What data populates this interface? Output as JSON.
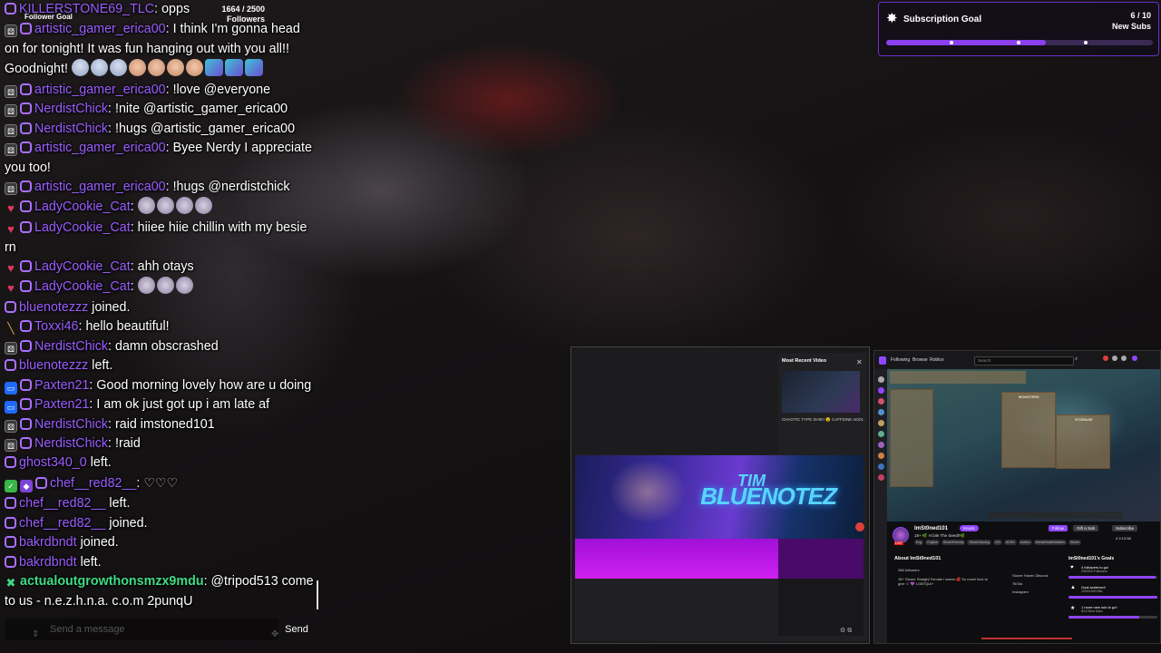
{
  "follower_goal": {
    "title": "Follower Goal",
    "count": "1664 / 2500",
    "unit": "Followers",
    "progress": 0.666
  },
  "chat": {
    "messages": [
      {
        "user": "KILLERSTONE69_TLC",
        "text": "opps"
      },
      {
        "user": "artistic_gamer_erica00",
        "text": "I think I'm gonna head on for tonight! It was fun hanging out with you all!! Goodnight!"
      },
      {
        "user": "artistic_gamer_erica00",
        "text": "!love @everyone"
      },
      {
        "user": "NerdistChick",
        "text": "!nite @artistic_gamer_erica00"
      },
      {
        "user": "NerdistChick",
        "text": "!hugs @artistic_gamer_erica00"
      },
      {
        "user": "artistic_gamer_erica00",
        "text": "Byee Nerdy I appreciate you too!"
      },
      {
        "user": "artistic_gamer_erica00",
        "text": "!hugs @nerdistchick"
      },
      {
        "user": "LadyCookie_Cat",
        "text": ""
      },
      {
        "user": "LadyCookie_Cat",
        "text": "hiiee hiie chillin with my besie rn"
      },
      {
        "user": "LadyCookie_Cat",
        "text": "ahh otays"
      },
      {
        "user": "LadyCookie_Cat",
        "text": ""
      },
      {
        "user": "bluenotezzz",
        "text": "joined."
      },
      {
        "user": "Toxxi46",
        "text": "hello beautiful!"
      },
      {
        "user": "NerdistChick",
        "text": "damn obscrashed"
      },
      {
        "user": "bluenotezzz",
        "text": "left."
      },
      {
        "user": "Paxten21",
        "text": "Good morning lovely how are u doing"
      },
      {
        "user": "Paxten21",
        "text": "I am ok just got up i am late af"
      },
      {
        "user": "NerdistChick",
        "text": "raid imstoned101"
      },
      {
        "user": "NerdistChick",
        "text": "!raid"
      },
      {
        "user": "ghost340_0",
        "text": "left."
      },
      {
        "user": "chef__red82__",
        "text": ""
      },
      {
        "user": "chef__red82__",
        "text": "left."
      },
      {
        "user": "chef__red82__",
        "text": "joined."
      },
      {
        "user": "bakrdbndt",
        "text": "joined."
      },
      {
        "user": "bakrdbndt",
        "text": "left."
      },
      {
        "user": "actualoutgrowthonsmzx9mdu",
        "text": "@tripod513 come to us - n.e.z.h.n.a. c.o.m 2punqU"
      }
    ],
    "input_placeholder": "Send a message",
    "send_label": "Send"
  },
  "subscription_goal": {
    "title": "Subscription Goal",
    "count": "6 / 10",
    "unit": "New Subs",
    "progress": 0.6
  },
  "video_window": {
    "recent_label": "Most Recent Video",
    "video_title": "CHAOTIC TYPE SHIII!! 😵 CAFFEINE ADDI...",
    "banner_text": "BLUENOTEZ",
    "banner_small": "TIM"
  },
  "twitch_window": {
    "nav": [
      "Following",
      "Browse",
      "Roblox"
    ],
    "search_placeholder": "Search",
    "channel_name": "ImSt0ned101",
    "channel_title": "18+ 🌿 H.bile The Seed!!🌿",
    "live_label": "LIVE",
    "knock_label": "Knock",
    "follow_label": "Follow",
    "gift_label": "Gift a Sub",
    "subscribe_label": "Subscribe",
    "viewers": "4  2:13:38",
    "tags": [
      "Eng",
      "English",
      "StonerFriendly",
      "StonerGaming",
      "420",
      "ADHD",
      "Autism",
      "MentalHealthMatters",
      "Stoner"
    ],
    "about_title": "About ImSt0ned101",
    "followers": "286 followers",
    "bio": "18+ Stoner Straight Female I swear 💋 So much love to give ☺ 💜 LGBTQIA+",
    "links": [
      "Stoner Haven Discord",
      "TikTok",
      "Instagram"
    ],
    "goals_title": "ImSt0ned101's Goals",
    "goals": [
      {
        "title": "4 followers to go!",
        "count": "296/300 Followers",
        "progress": 0.98
      },
      {
        "title": "Goal achieved!",
        "count": "1000/1000 Bits",
        "progress": 1.0
      },
      {
        "title": "1 more new sub to go!",
        "count": "8/10 New Subs",
        "progress": 0.8
      }
    ],
    "inventory_labels": [
      "MONSTERS",
      "STORAGE"
    ]
  },
  "colors": {
    "twitch_purple": "#9146ff",
    "username_purple": "#9b5cff",
    "spam_green": "#3ddc84",
    "live_red": "#e91916"
  }
}
